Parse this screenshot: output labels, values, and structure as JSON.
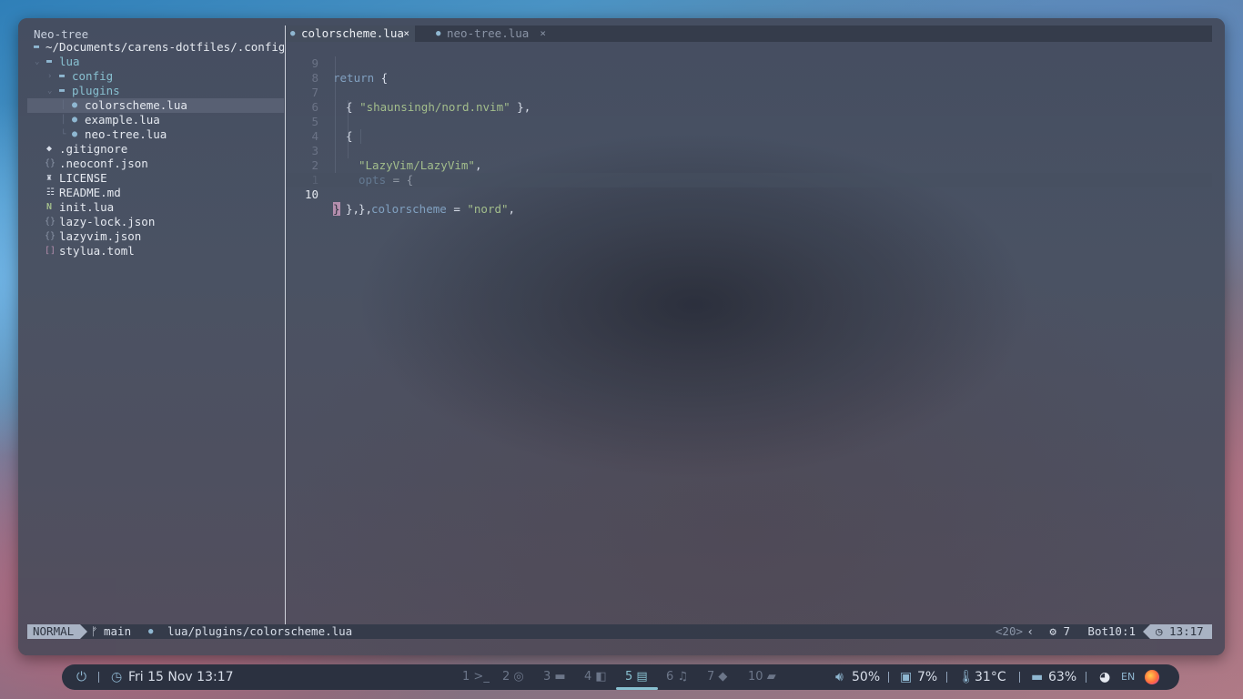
{
  "neotree": {
    "title": "Neo-tree",
    "root": "~/Documents/carens-dotfiles/.config/n",
    "items": [
      {
        "label": "lua",
        "type": "dir",
        "open": true
      },
      {
        "label": "config",
        "type": "dir",
        "open": false
      },
      {
        "label": "plugins",
        "type": "dir",
        "open": true
      },
      {
        "label": "colorscheme.lua",
        "type": "file"
      },
      {
        "label": "example.lua",
        "type": "file"
      },
      {
        "label": "neo-tree.lua",
        "type": "file"
      },
      {
        "label": ".gitignore",
        "type": "file"
      },
      {
        "label": ".neoconf.json",
        "type": "file"
      },
      {
        "label": "LICENSE",
        "type": "file"
      },
      {
        "label": "README.md",
        "type": "file"
      },
      {
        "label": "init.lua",
        "type": "file"
      },
      {
        "label": "lazy-lock.json",
        "type": "file"
      },
      {
        "label": "lazyvim.json",
        "type": "file"
      },
      {
        "label": "stylua.toml",
        "type": "file"
      }
    ]
  },
  "tabs": [
    {
      "label": "colorscheme.lua",
      "close": "×"
    },
    {
      "label": "neo-tree.lua",
      "close": "×"
    }
  ],
  "code": {
    "line_numbers": [
      "9",
      "8",
      "7",
      "6",
      "5",
      "4",
      "3",
      "2",
      "1",
      "10"
    ],
    "lines": {
      "l0_kw": "return",
      "l0_p": " {",
      "l1_a": "{ ",
      "l1_s": "\"shaunsingh/nord.nvim\"",
      "l1_b": " },",
      "l3": "{",
      "l4": "\"LazyVim/LazyVim\"",
      "l4_c": ",",
      "l5_k": "opts",
      "l5_p": " = {",
      "l6_k": "colorscheme",
      "l6_eq": " = ",
      "l6_s": "\"nord\"",
      "l6_c": ",",
      "l7": "},",
      "l8": "},",
      "l9": "}"
    }
  },
  "statusline": {
    "mode": "NORMAL",
    "branch_icon": "ᚠ",
    "branch": "main",
    "filepath": "lua/plugins/colorscheme.lua",
    "keys": "<20>",
    "diag": "⚙ 7",
    "position": "Bot",
    "cursor": "10:1",
    "time": "◷ 13:17"
  },
  "taskbar": {
    "power_icon": "⏻",
    "clock_icon": "◷",
    "datetime": "Fri 15 Nov 13:17",
    "workspaces": [
      {
        "num": "1",
        "icon": ">_"
      },
      {
        "num": "2",
        "icon": "◎"
      },
      {
        "num": "3",
        "icon": "▬"
      },
      {
        "num": "4",
        "icon": "◧"
      },
      {
        "num": "5",
        "icon": "▤"
      },
      {
        "num": "6",
        "icon": "♫"
      },
      {
        "num": "7",
        "icon": "◆"
      },
      {
        "num": "10",
        "icon": "▰"
      }
    ],
    "active_workspace": "5",
    "volume": "50%",
    "cpu": "7%",
    "temp": "31°C",
    "memory": "63%",
    "lang": "EN"
  },
  "colors": {
    "accent": "#88c0d0",
    "statusline_mode_bg": "#a9b3c4",
    "cursor": "#b48ead"
  }
}
